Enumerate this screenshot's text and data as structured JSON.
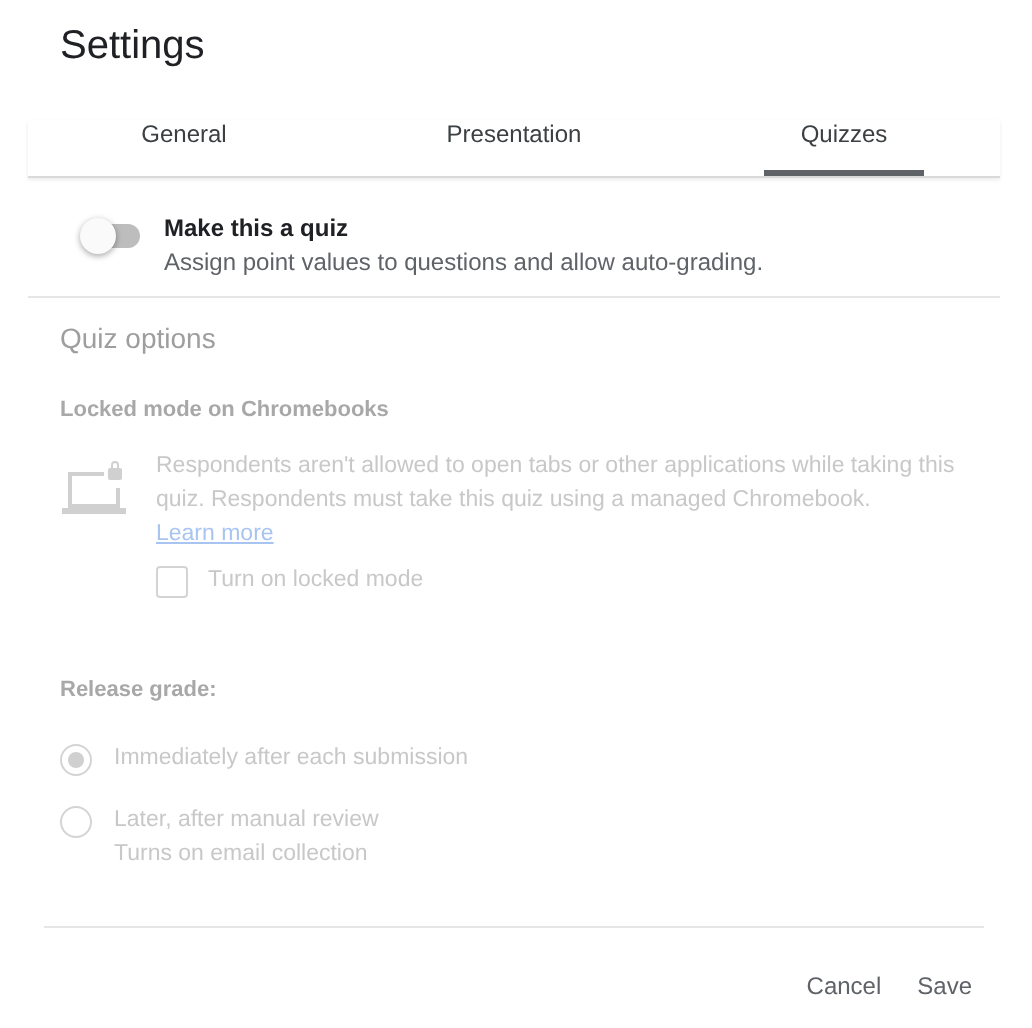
{
  "window": {
    "title": "Settings"
  },
  "tabs": [
    {
      "label": "General",
      "selected": false
    },
    {
      "label": "Presentation",
      "selected": false
    },
    {
      "label": "Quizzes",
      "selected": true
    }
  ],
  "quiz_toggle": {
    "label": "Make this a quiz",
    "description": "Assign point values to questions and allow auto-grading.",
    "on": false
  },
  "quiz_options": {
    "heading": "Quiz options",
    "disabled": true,
    "locked_mode": {
      "heading": "Locked mode on Chromebooks",
      "description": "Respondents aren't allowed to open tabs or other applications while taking this quiz. Respondents must take this quiz using a managed Chromebook.",
      "link": "Learn more",
      "checkbox": {
        "label": "Turn on locked mode",
        "checked": false
      }
    },
    "release_grade": {
      "heading": "Release grade:",
      "options": [
        {
          "label": "Immediately after each submission",
          "selected": true
        },
        {
          "label": "Later, after manual review",
          "sublabel": "Turns on email collection",
          "selected": false
        }
      ]
    }
  },
  "buttons": [
    "Cancel",
    "Save"
  ]
}
